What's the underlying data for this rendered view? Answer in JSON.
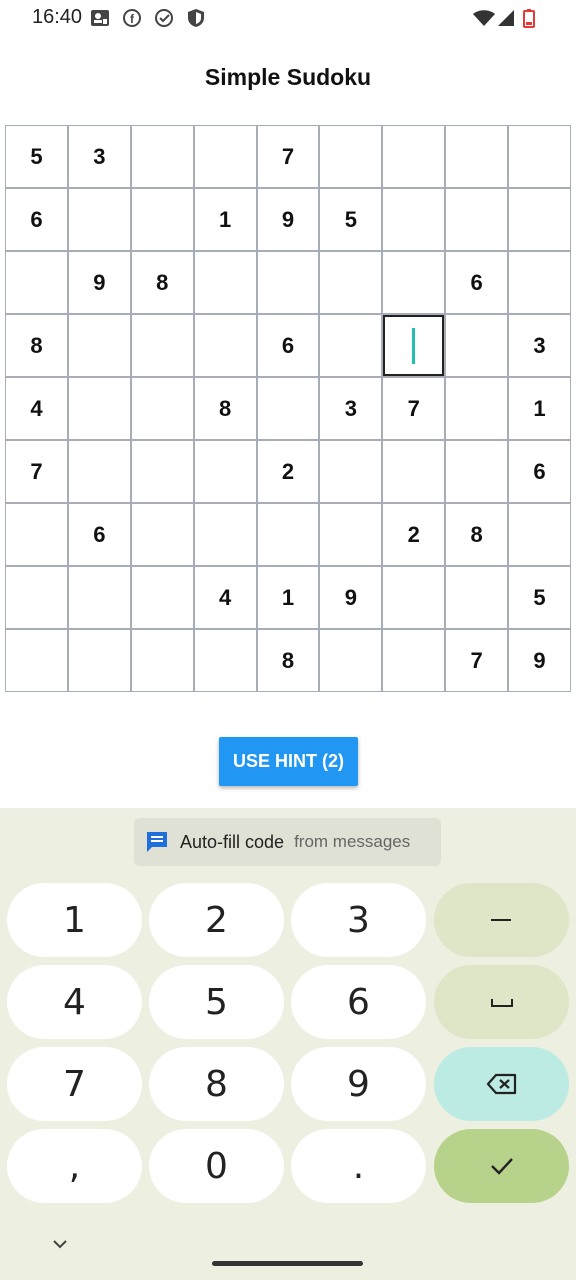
{
  "status_bar": {
    "time": "16:40"
  },
  "app": {
    "title": "Simple Sudoku"
  },
  "grid": {
    "rows": [
      [
        "5",
        "3",
        "",
        "",
        "7",
        "",
        "",
        "",
        ""
      ],
      [
        "6",
        "",
        "",
        "1",
        "9",
        "5",
        "",
        "",
        ""
      ],
      [
        "",
        "9",
        "8",
        "",
        "",
        "",
        "",
        "6",
        ""
      ],
      [
        "8",
        "",
        "",
        "",
        "6",
        "",
        "",
        "",
        "3"
      ],
      [
        "4",
        "",
        "",
        "8",
        "",
        "3",
        "7",
        "",
        "1"
      ],
      [
        "7",
        "",
        "",
        "",
        "2",
        "",
        "",
        "",
        "6"
      ],
      [
        "",
        "6",
        "",
        "",
        "",
        "",
        "2",
        "8",
        ""
      ],
      [
        "",
        "",
        "",
        "4",
        "1",
        "9",
        "",
        "",
        "5"
      ],
      [
        "",
        "",
        "",
        "",
        "8",
        "",
        "",
        "7",
        "9"
      ]
    ],
    "selected": {
      "row": 3,
      "col": 6
    }
  },
  "hint_button": {
    "label": "USE HINT (2)"
  },
  "keyboard": {
    "autofill": {
      "label": "Auto-fill code",
      "sublabel": "from messages"
    },
    "keys": [
      [
        "1",
        "2",
        "3",
        "–"
      ],
      [
        "4",
        "5",
        "6",
        "␣"
      ],
      [
        "7",
        "8",
        "9",
        "⌫"
      ],
      [
        ",",
        "0",
        ".",
        "✓"
      ]
    ]
  },
  "colors": {
    "accent": "#2196f3",
    "caret": "#22bfae",
    "keyboard_bg": "#edefe1",
    "enter_key": "#b6d28b",
    "delete_key": "#bcebe3"
  }
}
